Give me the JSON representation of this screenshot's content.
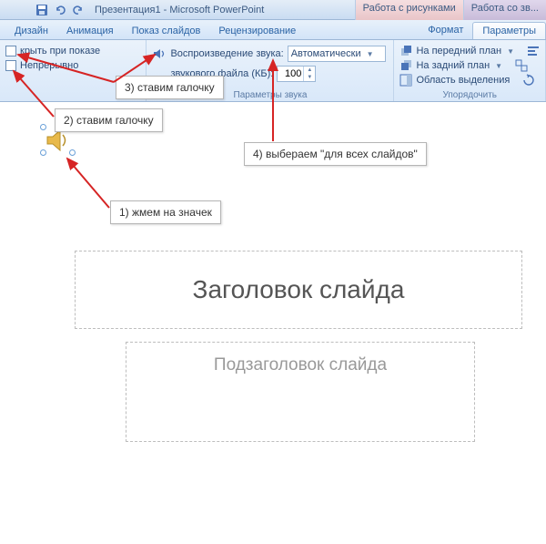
{
  "titlebar": {
    "doc_title": "Презентация1 - Microsoft PowerPoint",
    "context_tab1": "Работа с рисунками",
    "context_tab2": "Работа со зв..."
  },
  "tabs": {
    "design": "Дизайн",
    "animation": "Анимация",
    "slideshow": "Показ слайдов",
    "review": "Рецензирование",
    "format": "Формат",
    "parameters": "Параметры"
  },
  "ribbon": {
    "hide_on_show": "крыть при показе",
    "loop": "Непрерывно",
    "play_sound_label": "Воспроизведение звука:",
    "play_sound_value": "Автоматически",
    "sound_params": "Параметры звука",
    "max_file_label": "звукового файла (КБ):",
    "max_file_value": "100",
    "bring_front": "На передний план",
    "send_back": "На задний план",
    "selection_pane": "Область выделения",
    "arrange_label": "Упорядочить"
  },
  "callouts": {
    "c1": "1) жмем на значек",
    "c2": "2) ставим галочку",
    "c3": "3) ставим галочку",
    "c4": "4) выбераем \"для всех слайдов\""
  },
  "slide": {
    "title_placeholder": "Заголовок слайда",
    "subtitle_placeholder": "Подзаголовок слайда"
  }
}
